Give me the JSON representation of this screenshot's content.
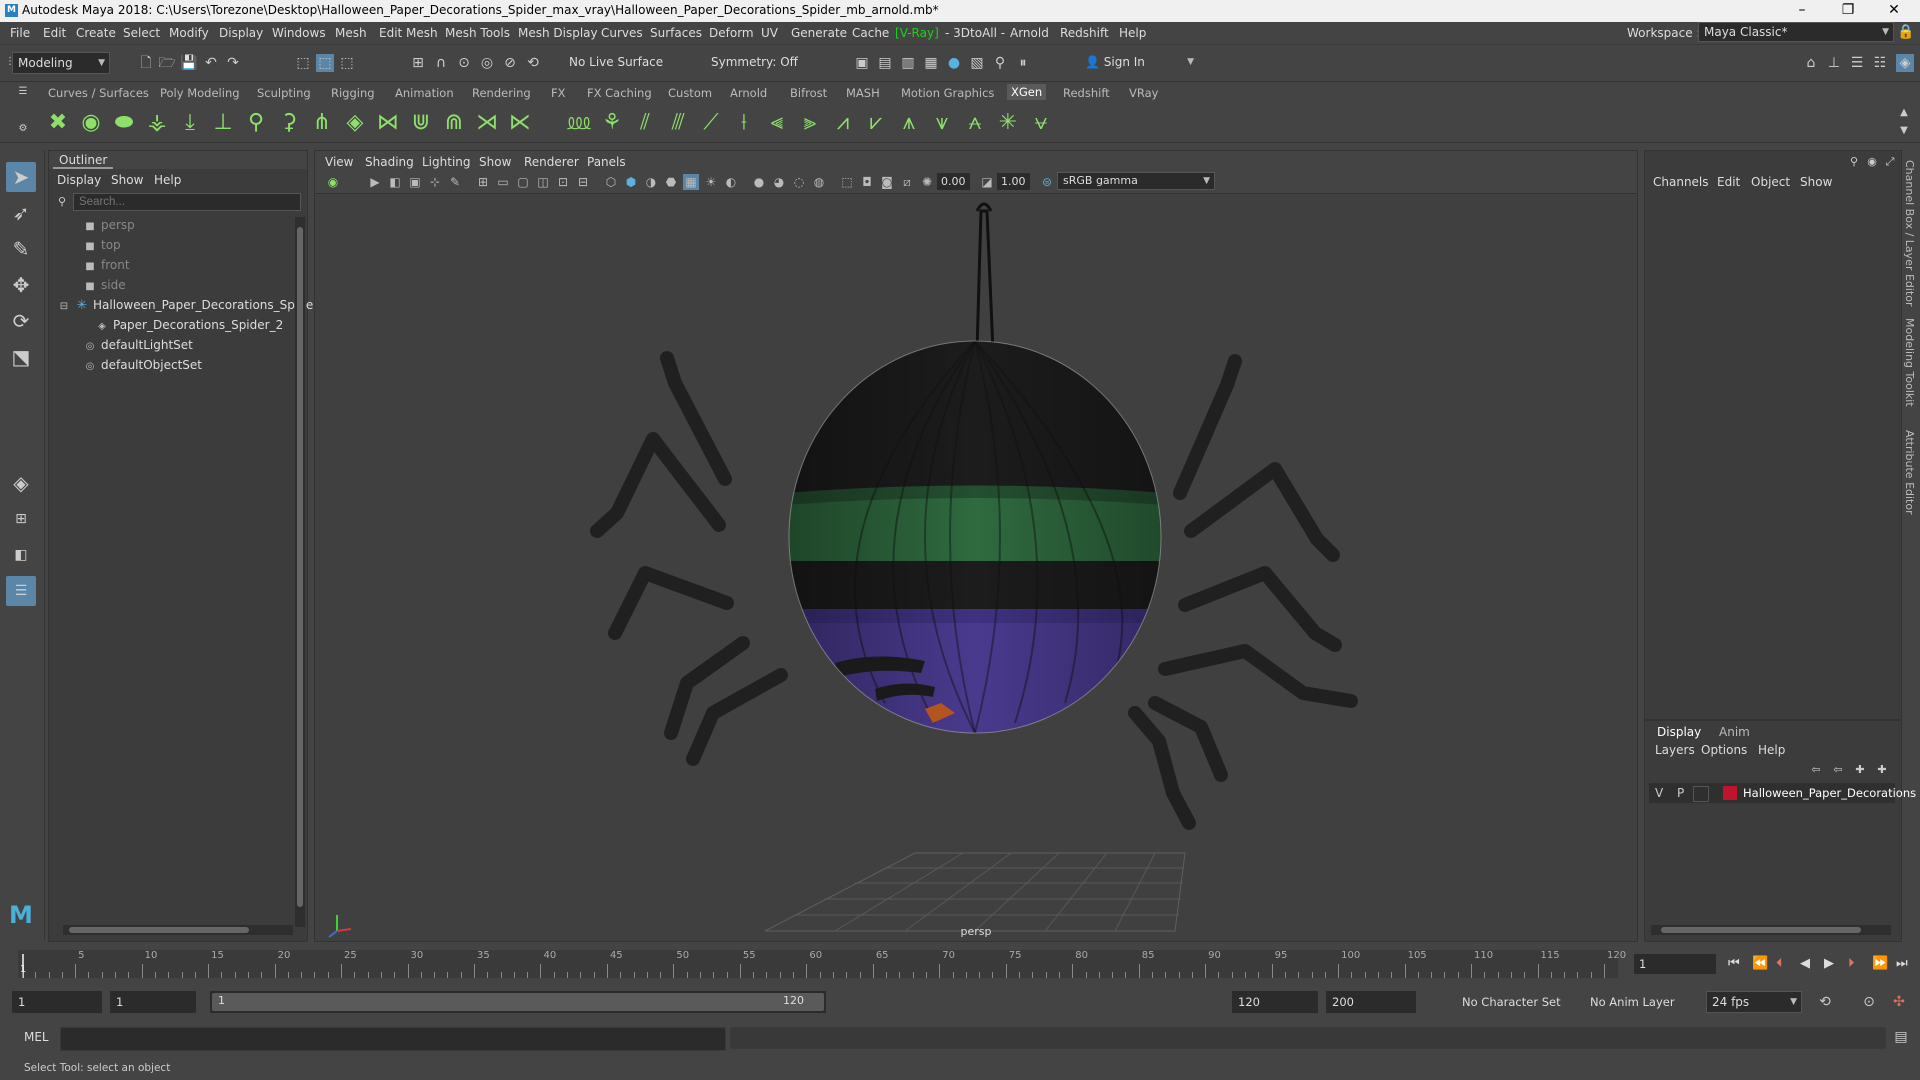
{
  "window": {
    "title": "Autodesk Maya 2018: C:\\Users\\Torezone\\Desktop\\Halloween_Paper_Decorations_Spider_max_vray\\Halloween_Paper_Decorations_Spider_mb_arnold.mb*",
    "minimize": "–",
    "maximize": "❐",
    "close": "✕"
  },
  "menubar": {
    "items": [
      "File",
      "Edit",
      "Create",
      "Select",
      "Modify",
      "Display",
      "Windows",
      "Mesh",
      "Edit Mesh",
      "Mesh Tools",
      "Mesh Display",
      "Curves",
      "Surfaces",
      "Deform",
      "UV",
      "Generate",
      "Cache",
      "V-Ray",
      "- 3DtoAll -",
      "Arnold",
      "Redshift",
      "Help"
    ],
    "workspace_label": "Workspace :",
    "workspace_value": "Maya Classic*"
  },
  "statusline": {
    "mode": "Modeling",
    "live_surface": "No Live Surface",
    "symmetry": "Symmetry: Off",
    "sign_in": "Sign In"
  },
  "shelf": {
    "tabs": [
      "Curves / Surfaces",
      "Poly Modeling",
      "Sculpting",
      "Rigging",
      "Animation",
      "Rendering",
      "FX",
      "FX Caching",
      "Custom",
      "Arnold",
      "Bifrost",
      "MASH",
      "Motion Graphics",
      "XGen",
      "Redshift",
      "VRay"
    ],
    "active_tab": "XGen",
    "accent_color": "#8de06a"
  },
  "outliner": {
    "title": "Outliner",
    "menus": [
      "Display",
      "Show",
      "Help"
    ],
    "search_placeholder": "Search...",
    "items": [
      {
        "label": "persp",
        "icon": "camera-icon",
        "dim": true
      },
      {
        "label": "top",
        "icon": "camera-icon",
        "dim": true
      },
      {
        "label": "front",
        "icon": "camera-icon",
        "dim": true
      },
      {
        "label": "side",
        "icon": "camera-icon",
        "dim": true
      },
      {
        "label": "Halloween_Paper_Decorations_Spide",
        "icon": "group-icon",
        "dim": false
      },
      {
        "label": "Paper_Decorations_Spider_2",
        "icon": "mesh-icon",
        "dim": false
      },
      {
        "label": "defaultLightSet",
        "icon": "set-icon",
        "dim": false
      },
      {
        "label": "defaultObjectSet",
        "icon": "set-icon",
        "dim": false
      }
    ]
  },
  "viewport": {
    "menus": [
      "View",
      "Shading",
      "Lighting",
      "Show",
      "Renderer",
      "Panels"
    ],
    "exposure": "0.00",
    "gamma": "1.00",
    "colorspace": "sRGB gamma",
    "camera_label": "persp",
    "colors": {
      "black": "#1c1c1c",
      "green": "#2f6a3f",
      "purple": "#4a3a8f",
      "legs": "#202020",
      "orange": "#b4551f"
    }
  },
  "channelbox": {
    "menus": [
      "Channels",
      "Edit",
      "Object",
      "Show"
    ]
  },
  "sidetabs": [
    "Channel Box / Layer Editor",
    "Modeling Toolkit",
    "Attribute Editor"
  ],
  "layers": {
    "tabs": [
      "Display",
      "Anim"
    ],
    "active_tab": "Display",
    "menus": [
      "Layers",
      "Options",
      "Help"
    ],
    "row": {
      "v": "V",
      "p": "P",
      "name": "Halloween_Paper_Decorations",
      "color": "#c0142e"
    }
  },
  "timeline": {
    "ticks": [
      "5",
      "10",
      "15",
      "20",
      "25",
      "30",
      "35",
      "40",
      "45",
      "50",
      "55",
      "60",
      "65",
      "70",
      "75",
      "80",
      "85",
      "90",
      "95",
      "100",
      "105",
      "110",
      "115",
      "120"
    ],
    "current_frame": "1",
    "frame_field": "1"
  },
  "range": {
    "start": "1",
    "start_inner": "1",
    "slider_start": "1",
    "slider_end": "120",
    "end": "120",
    "end_outer": "200",
    "character_set": "No Character Set",
    "anim_layer": "No Anim Layer",
    "fps": "24 fps"
  },
  "cmdline": {
    "label": "MEL"
  },
  "helpline": {
    "text": "Select Tool: select an object"
  }
}
